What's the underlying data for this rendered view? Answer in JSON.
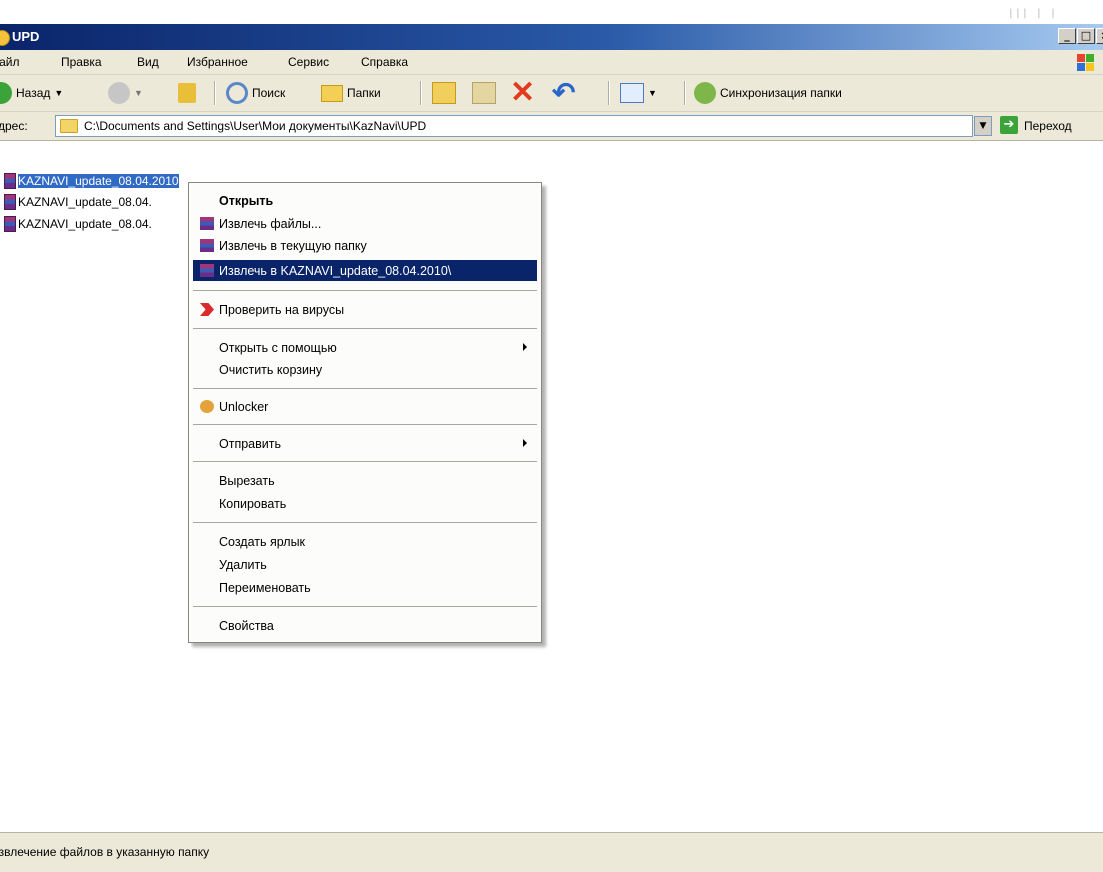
{
  "window": {
    "title": "UPD",
    "controls": {
      "minimize": "_",
      "maximize": "□",
      "close": "×"
    }
  },
  "menubar": {
    "items": [
      "Файл",
      "Правка",
      "Вид",
      "Избранное",
      "Сервис",
      "Справка"
    ]
  },
  "toolbar": {
    "back_label": "Назад",
    "search_label": "Поиск",
    "folders_label": "Папки",
    "sync_label": "Синхронизация папки"
  },
  "address": {
    "label": "Адрес:",
    "path": "C:\\Documents and Settings\\User\\Мои документы\\KazNavi\\UPD",
    "go_label": "Переход"
  },
  "files": [
    {
      "name": "KAZNAVI_update_08.04.2010",
      "selected": true
    },
    {
      "name": "KAZNAVI_update_08.04."
    },
    {
      "name": "KAZNAVI_update_08.04."
    }
  ],
  "context_menu": {
    "open": "Открыть",
    "extract_files": "Извлечь файлы...",
    "extract_here": "Извлечь в текущую папку",
    "extract_to": "Извлечь в KAZNAVI_update_08.04.2010\\",
    "scan": "Проверить на вирусы",
    "open_with": "Открыть с помощью",
    "empty_bin": "Очистить корзину",
    "unlocker": "Unlocker",
    "send_to": "Отправить",
    "cut": "Вырезать",
    "copy": "Копировать",
    "create_shortcut": "Создать ярлык",
    "delete": "Удалить",
    "rename": "Переименовать",
    "properties": "Свойства"
  },
  "statusbar": {
    "text": "Извлечение файлов в указанную папку"
  },
  "colors": {
    "title_bar": "#0a246a",
    "menu_highlight": "#0a246a",
    "selection": "#316ac5",
    "chrome": "#ece9d8"
  }
}
